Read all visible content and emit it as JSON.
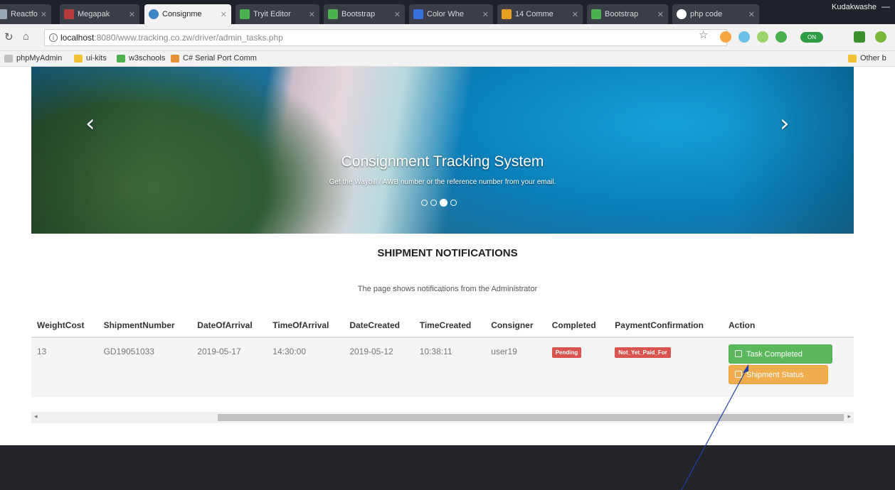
{
  "browser": {
    "tabs": [
      {
        "title": "Reactfo",
        "color": "#9aa7b5"
      },
      {
        "title": "Megapak",
        "color": "#b83b3b"
      },
      {
        "title": "Consignme",
        "color": "#3c84c4",
        "active": true
      },
      {
        "title": "Tryit Editor",
        "color": "#4caf50"
      },
      {
        "title": "Bootstrap",
        "color": "#4caf50"
      },
      {
        "title": "Color Whe",
        "color": "#3a6ed8"
      },
      {
        "title": "14 Comme",
        "color": "#e8a024"
      },
      {
        "title": "Bootstrap",
        "color": "#4caf50"
      },
      {
        "title": "php code",
        "color": "#ffffff"
      }
    ],
    "user_label": "Kudakwashe",
    "url_host": "localhost",
    "url_rest": ":8080/www.tracking.co.zw/driver/admin_tasks.php",
    "bookmarks": [
      {
        "label": "phpMyAdmin",
        "color": "#c0c0c0"
      },
      {
        "label": "ui-kits",
        "color": "#f1c232"
      },
      {
        "label": "w3schools",
        "color": "#4caf50"
      },
      {
        "label": "C# Serial Port Comm",
        "color": "#e69138"
      }
    ],
    "other_bookmarks": "Other b"
  },
  "carousel": {
    "title": "Consignment Tracking System",
    "subtitle": "Get the Waybill / AWB number or the reference number from your email.",
    "prev_icon": "chevron-left-icon",
    "next_icon": "chevron-right-icon",
    "indicator_count": 4,
    "active_indicator": 3
  },
  "section": {
    "title": "SHIPMENT NOTIFICATIONS",
    "subtitle": "The page shows notifications from the Administrator"
  },
  "table": {
    "columns": [
      "WeightCost",
      "ShipmentNumber",
      "DateOfArrival",
      "TimeOfArrival",
      "DateCreated",
      "TimeCreated",
      "Consigner",
      "Completed",
      "PaymentConfirmation",
      "Action"
    ],
    "rows": [
      {
        "weight_cost": "13",
        "shipment_number": "GD19051033",
        "date_of_arrival": "2019-05-17",
        "time_of_arrival": "14:30:00",
        "date_created": "2019-05-12",
        "time_created": "10:38:11",
        "consigner": "user19",
        "completed": "Pending",
        "payment_confirmation": "Not_Yet_Paid_For",
        "task_completed_label": "Task Completed",
        "shipment_status_label": "Shipment Status"
      }
    ]
  },
  "colors": {
    "success": "#5cb85c",
    "warning": "#f0ad4e",
    "danger": "#d9534f",
    "footer": "#222429"
  }
}
